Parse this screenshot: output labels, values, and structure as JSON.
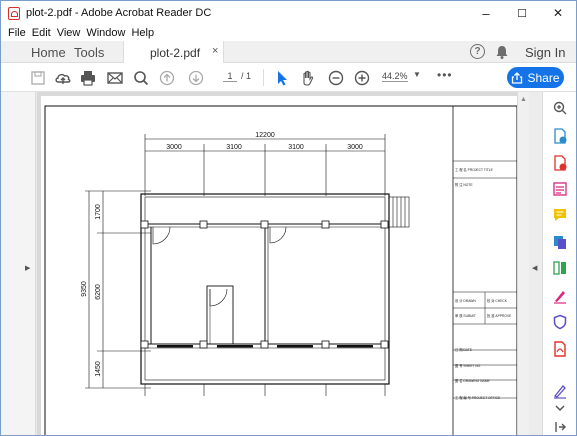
{
  "window": {
    "title": "plot-2.pdf - Adobe Acrobat Reader DC",
    "controls": {
      "minimize": "–",
      "maximize": "☐",
      "close": "✕"
    }
  },
  "menubar": {
    "items": [
      "File",
      "Edit",
      "View",
      "Window",
      "Help"
    ]
  },
  "tabs": {
    "home": "Home",
    "tools": "Tools",
    "document": "plot-2.pdf",
    "close": "×",
    "help": "?",
    "signin": "Sign In"
  },
  "toolbar": {
    "page_current": "1",
    "page_total": "/ 1",
    "zoom": "44.2%",
    "zoom_caret": "▼",
    "more": "•••",
    "share": "Share"
  },
  "drawing": {
    "overall_width": "12200",
    "bay_widths": [
      "3000",
      "3100",
      "3100",
      "3000"
    ],
    "overall_height": "9350",
    "bay_heights": [
      "1700",
      "6200",
      "1450"
    ],
    "title_block": [
      "工 程 名 PROJECT TITLE",
      "附 注 NOTE",
      "设 计 DRAWN",
      "校 对 CHECK",
      "审 核 SUBMIT",
      "批 准 APPROVE",
      "日 期 DATE",
      "图 号 SHEET NO.",
      "图 名 DRAWING NAME",
      "工 程 编 号 PROJECT OFFICE"
    ]
  },
  "icons": {
    "colors": {
      "accent": "#1473e6",
      "red": "#e0312b",
      "green": "#2fa44f",
      "magenta": "#d9277e",
      "yellow": "#f2c200",
      "purple": "#5b4fc9"
    }
  }
}
